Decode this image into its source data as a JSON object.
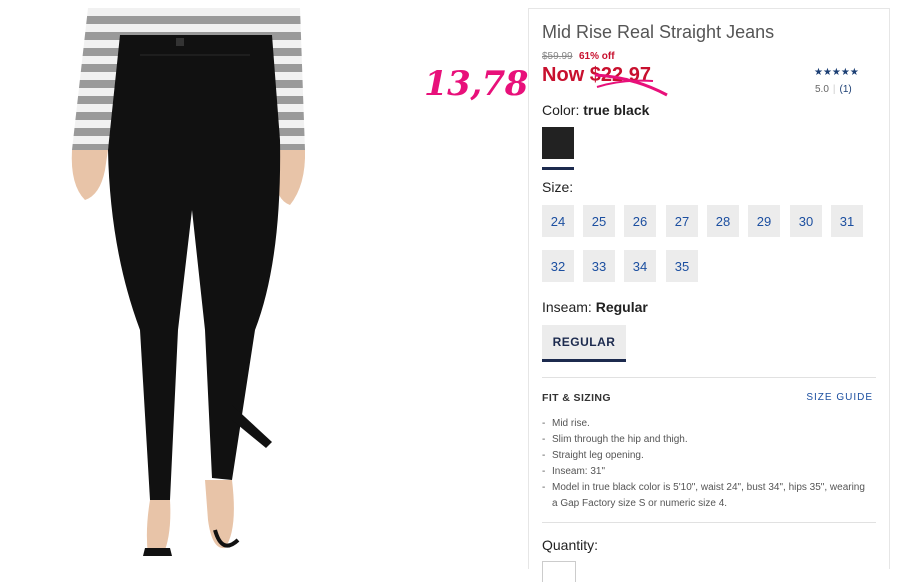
{
  "product": {
    "title": "Mid Rise Real Straight Jeans",
    "original_price": "$59.99",
    "discount": "61% off",
    "now_price": "Now $22.97"
  },
  "annotation": {
    "handwritten_price": "13,78",
    "color": "#e8107a"
  },
  "rating": {
    "stars": "★★★★★",
    "score": "5.0",
    "count": "(1)"
  },
  "color": {
    "label": "Color:",
    "value": "true black",
    "swatch": "#222222"
  },
  "size": {
    "label": "Size:",
    "options": [
      "24",
      "25",
      "26",
      "27",
      "28",
      "29",
      "30",
      "31",
      "32",
      "33",
      "34",
      "35"
    ]
  },
  "inseam": {
    "label": "Inseam:",
    "value": "Regular",
    "button": "REGULAR"
  },
  "fit": {
    "title": "FIT & SIZING",
    "size_guide": "SIZE GUIDE",
    "items": [
      "Mid rise.",
      "Slim through the hip and thigh.",
      "Straight leg opening.",
      "Inseam: 31\"",
      "Model in true black color is 5'10\", waist 24\", bust 34\", hips 35\", wearing a Gap Factory size S or numeric size 4."
    ]
  },
  "quantity": {
    "label": "Quantity:"
  },
  "colors": {
    "sale": "#c8102e",
    "brand_navy": "#1c2a4e",
    "link": "#1c4fa0"
  }
}
